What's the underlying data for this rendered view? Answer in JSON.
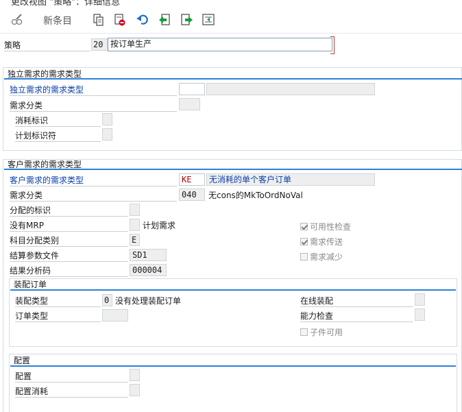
{
  "window": {
    "title": "更改视图 \"策略\"：详细信息"
  },
  "toolbar": {
    "new_entries_label": "新条目"
  },
  "header": {
    "strategy_label": "策略",
    "strategy_code": "20",
    "strategy_name": "按订单生产"
  },
  "independent": {
    "title": "独立需求的需求类型",
    "req_type_label": "独立需求的需求类型",
    "req_type_code": "",
    "req_type_desc": "",
    "req_class_label": "需求分类",
    "req_class_value": "",
    "consumption_label": "消耗标识",
    "consumption_value": "",
    "planning_label": "计划标识符",
    "planning_value": ""
  },
  "customer": {
    "title": "客户需求的需求类型",
    "req_type_label": "客户需求的需求类型",
    "req_type_code": "KE",
    "req_type_desc": "无消耗的单个客户订单",
    "req_class_label": "需求分类",
    "req_class_value": "040",
    "req_class_desc": "无cons的MkToOrdNoVal",
    "allocation_label": "分配的标识",
    "allocation_value": "",
    "no_mrp_label": "没有MRP",
    "no_mrp_value": "",
    "no_mrp_desc": "计划需求",
    "acct_assign_label": "科目分配类别",
    "acct_assign_value": "E",
    "settle_profile_label": "结算参数文件",
    "settle_profile_value": "SD1",
    "result_analysis_label": "结果分析码",
    "result_analysis_value": "000004",
    "availability_check_label": "可用性检查",
    "req_transfer_label": "需求传送",
    "req_reduction_label": "需求减少"
  },
  "assembly": {
    "title": "装配订单",
    "type_label": "装配类型",
    "type_value": "0",
    "type_desc": "没有处理装配订单",
    "order_type_label": "订单类型",
    "order_type_value": "",
    "online_label": "在线装配",
    "online_value": "",
    "capacity_label": "能力检查",
    "capacity_value": "",
    "components_label": "子件可用"
  },
  "config": {
    "title": "配置",
    "config_label": "配置",
    "config_value": "",
    "consumption_label": "配置消耗",
    "consumption_value": ""
  }
}
